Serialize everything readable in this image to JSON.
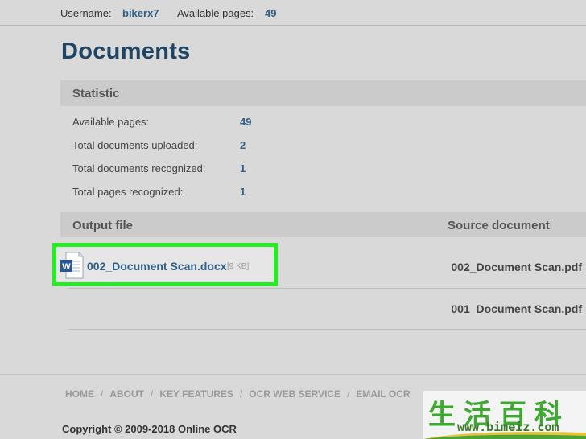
{
  "header": {
    "username_label": "Username:",
    "username": "bikerx7",
    "pages_label": "Available pages:",
    "pages": "49"
  },
  "page_title": "Documents",
  "statistic": {
    "heading": "Statistic",
    "rows": [
      {
        "label": "Available pages:",
        "value": "49"
      },
      {
        "label": "Total documents uploaded:",
        "value": "2"
      },
      {
        "label": "Total documents recognized:",
        "value": "1"
      },
      {
        "label": "Total pages recognized:",
        "value": "1"
      }
    ]
  },
  "files": {
    "col_output": "Output file",
    "col_source": "Source document",
    "rows": [
      {
        "output": "002_Document Scan.docx",
        "size": "[9 KB]",
        "source": "002_Document Scan.pdf",
        "output_icon": "word-doc-icon"
      },
      {
        "output": "",
        "size": "",
        "source": "001_Document Scan.pdf"
      }
    ]
  },
  "footer": {
    "nav": [
      "HOME",
      "ABOUT",
      "KEY FEATURES",
      "OCR WEB SERVICE",
      "EMAIL OCR"
    ],
    "copyright": "Copyright © 2009-2018 Online OCR"
  },
  "watermark": {
    "chars": "生活百科",
    "url": "www.bimeiz.com"
  },
  "colors": {
    "accent": "#2f5e86",
    "title": "#1f4565",
    "highlight": "#22ee22",
    "background": "#d9d9d9"
  }
}
